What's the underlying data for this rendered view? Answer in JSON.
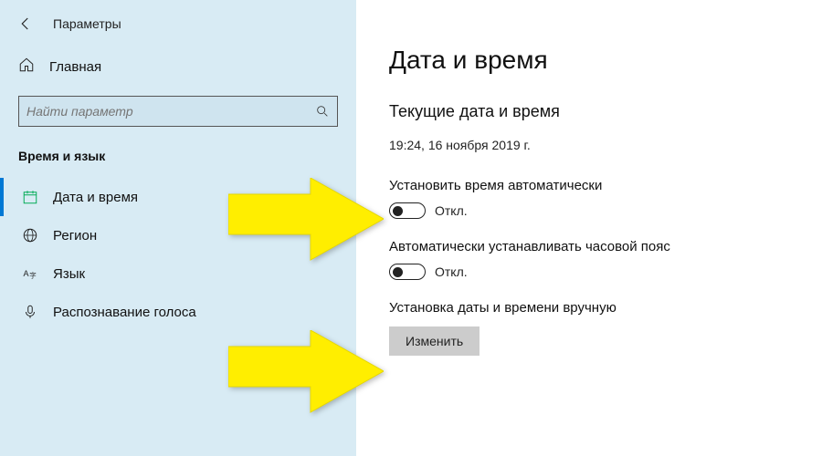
{
  "header": {
    "title": "Параметры"
  },
  "home": {
    "label": "Главная"
  },
  "search": {
    "placeholder": "Найти параметр"
  },
  "section": {
    "title": "Время и язык"
  },
  "nav": {
    "items": [
      {
        "label": "Дата и время"
      },
      {
        "label": "Регион"
      },
      {
        "label": "Язык"
      },
      {
        "label": "Распознавание голоса"
      }
    ]
  },
  "content": {
    "title": "Дата и время",
    "currentHeading": "Текущие дата и время",
    "currentValue": "19:24, 16 ноября 2019 г.",
    "autoTime": {
      "label": "Установить время автоматически",
      "state": "Откл."
    },
    "autoZone": {
      "label": "Автоматически устанавливать часовой пояс",
      "state": "Откл."
    },
    "manual": {
      "label": "Установка даты и времени вручную",
      "button": "Изменить"
    }
  }
}
